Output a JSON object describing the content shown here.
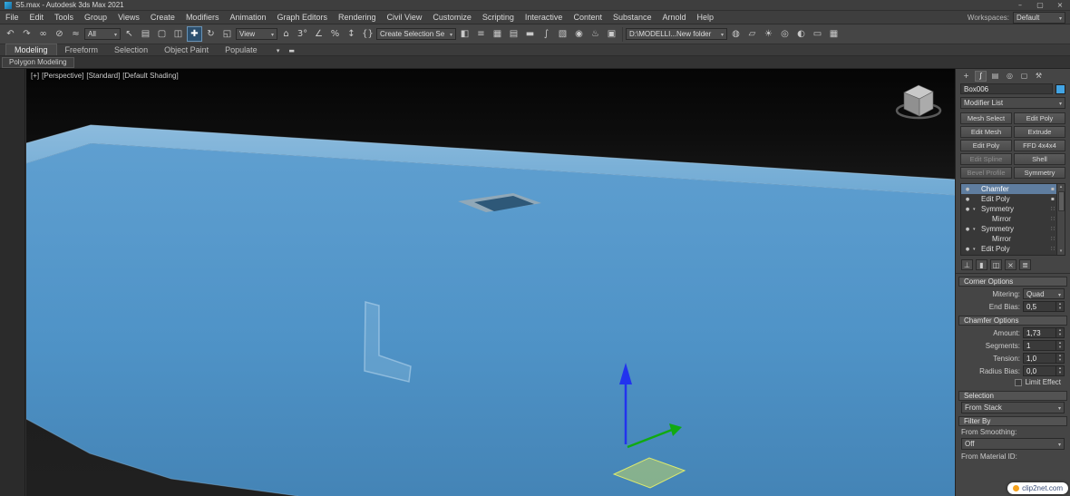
{
  "colors": {
    "object_front": "#4f93c7",
    "object_top": "#7fb2d8",
    "stack_selection": "#5f7d9f",
    "object_swatch": "#42a4e4",
    "gizmo_z_axis": "#2233ee",
    "gizmo_y_axis": "#11aa11",
    "gizmo_plane": "#c8dc64"
  },
  "titlebar": {
    "title": "S5.max - Autodesk 3ds Max 2021",
    "minimize": "–",
    "maximize": "▢",
    "close": "×"
  },
  "menubar": {
    "items": [
      "File",
      "Edit",
      "Tools",
      "Group",
      "Views",
      "Create",
      "Modifiers",
      "Animation",
      "Graph Editors",
      "Rendering",
      "Civil View",
      "Customize",
      "Scripting",
      "Interactive",
      "Content",
      "Substance",
      "Arnold",
      "Help"
    ],
    "workspaces_label": "Workspaces:",
    "workspace_value": "Default"
  },
  "toolbar": {
    "selection_filter": "All",
    "view_dropdown": "View",
    "named_sets": "Create Selection Se",
    "project_folder": "D:\\MODELLI...New folder",
    "icons_a": [
      {
        "name": "undo-icon",
        "glyph": "↶"
      },
      {
        "name": "redo-icon",
        "glyph": "↷"
      },
      {
        "name": "select-and-link-icon",
        "glyph": "∞"
      },
      {
        "name": "unlink-selection-icon",
        "glyph": "⊘"
      },
      {
        "name": "bind-to-space-warp-icon",
        "glyph": "≈"
      }
    ],
    "icons_b": [
      {
        "name": "select-object-icon",
        "glyph": "↖"
      },
      {
        "name": "select-by-name-icon",
        "glyph": "▤"
      },
      {
        "name": "rectangular-selection-region-icon",
        "glyph": "▢"
      },
      {
        "name": "window-crossing-icon",
        "glyph": "◫"
      },
      {
        "name": "select-and-move-icon",
        "glyph": "✚",
        "active": true
      },
      {
        "name": "select-and-rotate-icon",
        "glyph": "↻"
      },
      {
        "name": "select-and-scale-icon",
        "glyph": "◱"
      }
    ],
    "icons_c": [
      {
        "name": "select-and-place-icon",
        "glyph": "⌂"
      },
      {
        "name": "snaps-toggle-icon",
        "glyph": "3°"
      },
      {
        "name": "angle-snap-icon",
        "glyph": "∠"
      },
      {
        "name": "percent-snap-icon",
        "glyph": "%"
      },
      {
        "name": "spinner-snap-icon",
        "glyph": "↕"
      },
      {
        "name": "named-selection-sets-icon",
        "glyph": "{}"
      }
    ],
    "icons_d": [
      {
        "name": "mirror-icon",
        "glyph": "◧"
      },
      {
        "name": "align-icon",
        "glyph": "≡"
      },
      {
        "name": "scene-explorer-icon",
        "glyph": "▦"
      },
      {
        "name": "layer-explorer-icon",
        "glyph": "▤"
      },
      {
        "name": "ribbon-toggle-icon",
        "glyph": "▬"
      },
      {
        "name": "curve-editor-icon",
        "glyph": "∫"
      },
      {
        "name": "schematic-view-icon",
        "glyph": "▧"
      },
      {
        "name": "material-editor-icon",
        "glyph": "◉"
      },
      {
        "name": "render-setup-icon",
        "glyph": "♨"
      },
      {
        "name": "rendered-frame-icon",
        "glyph": "▣"
      }
    ],
    "icons_e": [
      {
        "name": "render-production-icon",
        "glyph": "◍"
      },
      {
        "name": "open-folder-icon",
        "glyph": "▱"
      },
      {
        "name": "lights-icon",
        "glyph": "☀"
      },
      {
        "name": "cameras-icon",
        "glyph": "◎"
      },
      {
        "name": "arnold-render-icon",
        "glyph": "◐"
      },
      {
        "name": "render-region-icon",
        "glyph": "▭"
      },
      {
        "name": "grid-helper-icon",
        "glyph": "▦"
      }
    ]
  },
  "ribbon": {
    "tabs": [
      {
        "label": "Modeling",
        "active": true
      },
      {
        "label": "Freeform"
      },
      {
        "label": "Selection"
      },
      {
        "label": "Object Paint"
      },
      {
        "label": "Populate"
      }
    ],
    "extra_icons": [
      {
        "name": "chevron-down-icon",
        "glyph": "▾"
      },
      {
        "name": "ribbon-options-icon",
        "glyph": "▬"
      }
    ],
    "panel_tab": "Polygon Modeling"
  },
  "viewport": {
    "menus": [
      {
        "name": "viewport-general-menu",
        "label": "[+]"
      },
      {
        "name": "viewport-pov-menu",
        "label": "[Perspective]"
      },
      {
        "name": "viewport-renderer-menu",
        "label": "[Standard]"
      },
      {
        "name": "viewport-shading-menu",
        "label": "[Default Shading]"
      }
    ]
  },
  "command_panel": {
    "tabs": [
      {
        "name": "create-tab-icon",
        "glyph": "+"
      },
      {
        "name": "modify-tab-icon",
        "glyph": "∫",
        "active": true
      },
      {
        "name": "hierarchy-tab-icon",
        "glyph": "▤"
      },
      {
        "name": "motion-tab-icon",
        "glyph": "◎"
      },
      {
        "name": "display-tab-icon",
        "glyph": "▢"
      },
      {
        "name": "utilities-tab-icon",
        "glyph": "⚒"
      }
    ],
    "object_name": "Box006",
    "modifier_list_label": "Modifier List",
    "modifier_buttons": [
      {
        "label": "Mesh Select"
      },
      {
        "label": "Edit Poly"
      },
      {
        "label": "Edit Mesh"
      },
      {
        "label": "Extrude"
      },
      {
        "label": "Edit Poly"
      },
      {
        "label": "FFD 4x4x4"
      },
      {
        "label": "Edit Spline",
        "disabled": true
      },
      {
        "label": "Shell"
      },
      {
        "label": "Bevel Profile",
        "disabled": true
      },
      {
        "label": "Symmetry"
      }
    ],
    "stack": [
      {
        "label": "Chamfer",
        "indent": 0,
        "selected": true,
        "left": "●",
        "right": "▪"
      },
      {
        "label": "Edit Poly",
        "indent": 0,
        "left": "●",
        "right": "▪"
      },
      {
        "label": "Symmetry",
        "indent": 0,
        "left": "●",
        "expand": "▾",
        "right": "∷"
      },
      {
        "label": "Mirror",
        "indent": 1,
        "right": "∷"
      },
      {
        "label": "Symmetry",
        "indent": 0,
        "left": "●",
        "expand": "▾",
        "right": "∷"
      },
      {
        "label": "Mirror",
        "indent": 1,
        "right": "∷"
      },
      {
        "label": "Edit Poly",
        "indent": 0,
        "left": "●",
        "expand": "▾",
        "right": "∷"
      }
    ],
    "stack_tools": [
      {
        "name": "pin-stack-icon",
        "glyph": "⊥"
      },
      {
        "name": "show-end-result-icon",
        "glyph": "▮"
      },
      {
        "name": "make-unique-icon",
        "glyph": "◫"
      },
      {
        "name": "remove-modifier-icon",
        "glyph": "×"
      },
      {
        "name": "configure-modifier-sets-icon",
        "glyph": "≣"
      }
    ],
    "corner_options": {
      "title": "Corner Options",
      "mitering_label": "Mitering:",
      "mitering_value": "Quad",
      "end_bias_label": "End Bias:",
      "end_bias_value": "0,5"
    },
    "chamfer_options": {
      "title": "Chamfer Options",
      "fields": [
        {
          "label": "Amount:",
          "value": "1,73"
        },
        {
          "label": "Segments:",
          "value": "1"
        },
        {
          "label": "Tension:",
          "value": "1,0"
        },
        {
          "label": "Radius Bias:",
          "value": "0,0"
        }
      ],
      "limit_effect_label": "Limit Effect"
    },
    "selection": {
      "title": "Selection",
      "value": "From Stack"
    },
    "filter_by": {
      "title": "Filter By",
      "smoothing_label": "From Smoothing:",
      "smoothing_value": "Off",
      "material_label": "From Material ID:"
    }
  },
  "watermark": {
    "text": "clip2net.com"
  }
}
